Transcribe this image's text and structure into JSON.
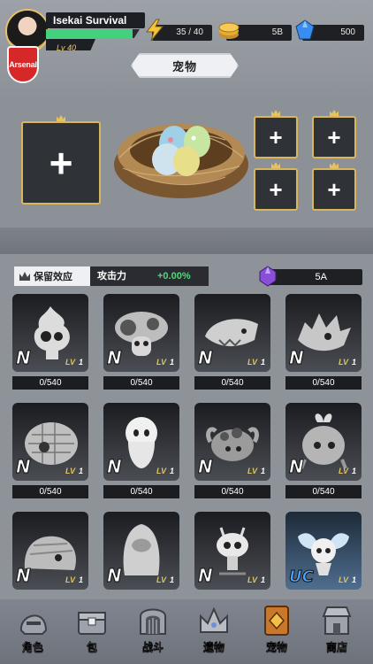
{
  "player": {
    "name": "Isekai Survival",
    "level": "Lv 40",
    "xp_fraction": 0.92,
    "badge_text": "Arsenal"
  },
  "resources": {
    "energy": "35 / 40",
    "coins": "5B",
    "gems": "500"
  },
  "page_title": "宠物",
  "retain_effect": {
    "label": "保留效应",
    "stat_label": "攻击力",
    "stat_value": "+0.00%"
  },
  "essence": {
    "value": "5A"
  },
  "slots_plus": "+",
  "pets": [
    {
      "rank": "N",
      "lv_label": "LV",
      "lv": "1",
      "count": "0/540",
      "icon": "flame-skull-pet"
    },
    {
      "rank": "N",
      "lv_label": "LV",
      "lv": "1",
      "count": "0/540",
      "icon": "mushroom-pet"
    },
    {
      "rank": "N",
      "lv_label": "LV",
      "lv": "1",
      "count": "0/540",
      "icon": "shark-pet"
    },
    {
      "rank": "N",
      "lv_label": "LV",
      "lv": "1",
      "count": "0/540",
      "icon": "spiky-dragon-pet"
    },
    {
      "rank": "N",
      "lv_label": "LV",
      "lv": "1",
      "count": "0/540",
      "icon": "armadillo-pet"
    },
    {
      "rank": "N",
      "lv_label": "LV",
      "lv": "1",
      "count": "0/540",
      "icon": "ghost-pet"
    },
    {
      "rank": "N",
      "lv_label": "LV",
      "lv": "1",
      "count": "0/540",
      "icon": "crab-pet"
    },
    {
      "rank": "N",
      "lv_label": "LV",
      "lv": "1",
      "count": "0/540",
      "icon": "radish-pet"
    },
    {
      "rank": "N",
      "lv_label": "LV",
      "lv": "1",
      "count": "",
      "icon": "rock-beast-pet"
    },
    {
      "rank": "N",
      "lv_label": "LV",
      "lv": "1",
      "count": "",
      "icon": "hooded-ghost-pet"
    },
    {
      "rank": "N",
      "lv_label": "LV",
      "lv": "1",
      "count": "",
      "icon": "sprout-imp-pet"
    },
    {
      "rank": "UC",
      "lv_label": "LV",
      "lv": "1",
      "count": "",
      "icon": "winged-fairy-pet"
    }
  ],
  "nav": [
    {
      "label": "角色",
      "icon": "helmet-icon"
    },
    {
      "label": "包",
      "icon": "chest-icon"
    },
    {
      "label": "战斗",
      "icon": "gate-icon"
    },
    {
      "label": "遗物",
      "icon": "crown-icon"
    },
    {
      "label": "宠物",
      "icon": "book-icon",
      "active": true
    },
    {
      "label": "商店",
      "icon": "shop-icon"
    }
  ],
  "colors": {
    "accent_gold": "#d9b65c",
    "positive_green": "#58d47c",
    "uc_blue": "#4aa3ff"
  }
}
